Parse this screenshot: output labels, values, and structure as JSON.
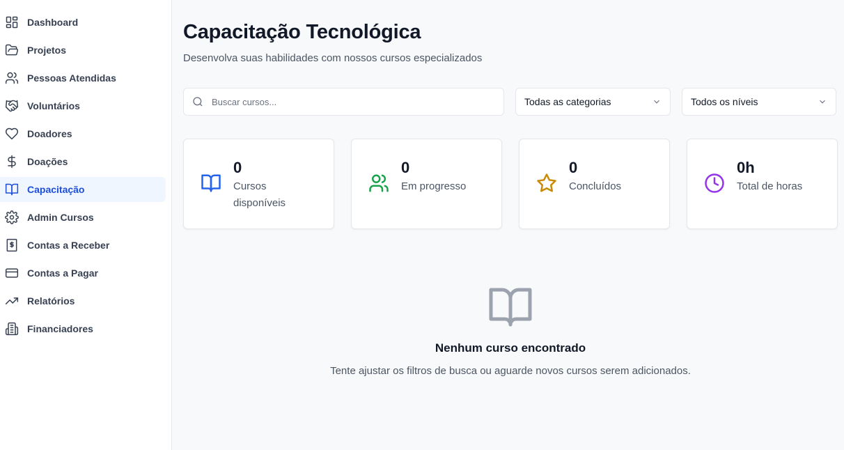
{
  "sidebar": {
    "items": [
      {
        "label": "Dashboard",
        "icon": "dashboard-icon",
        "active": false
      },
      {
        "label": "Projetos",
        "icon": "folder-open-icon",
        "active": false
      },
      {
        "label": "Pessoas Atendidas",
        "icon": "users-icon",
        "active": false
      },
      {
        "label": "Voluntários",
        "icon": "handshake-icon",
        "active": false
      },
      {
        "label": "Doadores",
        "icon": "heart-icon",
        "active": false
      },
      {
        "label": "Doações",
        "icon": "dollar-icon",
        "active": false
      },
      {
        "label": "Capacitação",
        "icon": "book-open-icon",
        "active": true
      },
      {
        "label": "Admin Cursos",
        "icon": "gear-icon",
        "active": false
      },
      {
        "label": "Contas a Receber",
        "icon": "receipt-icon",
        "active": false
      },
      {
        "label": "Contas a Pagar",
        "icon": "credit-card-icon",
        "active": false
      },
      {
        "label": "Relatórios",
        "icon": "trending-up-icon",
        "active": false
      },
      {
        "label": "Financiadores",
        "icon": "building-icon",
        "active": false
      }
    ]
  },
  "header": {
    "title": "Capacitação Tecnológica",
    "subtitle": "Desenvolva suas habilidades com nossos cursos especializados"
  },
  "filters": {
    "search_placeholder": "Buscar cursos...",
    "search_value": "",
    "category_selected": "Todas as categorias",
    "level_selected": "Todos os níveis"
  },
  "stats": [
    {
      "value": "0",
      "label": "Cursos disponíveis",
      "icon": "book-open-icon",
      "color": "#2563eb"
    },
    {
      "value": "0",
      "label": "Em progresso",
      "icon": "users-icon",
      "color": "#16a34a"
    },
    {
      "value": "0",
      "label": "Concluídos",
      "icon": "star-icon",
      "color": "#ca8a04"
    },
    {
      "value": "0h",
      "label": "Total de horas",
      "icon": "clock-icon",
      "color": "#9333ea"
    }
  ],
  "empty_state": {
    "icon": "book-open-icon",
    "title": "Nenhum curso encontrado",
    "text": "Tente ajustar os filtros de busca ou aguarde novos cursos serem adicionados."
  },
  "colors": {
    "accent": "#1d4ed8",
    "active_bg": "#eff6ff",
    "page_bg": "#f8f9fa"
  }
}
